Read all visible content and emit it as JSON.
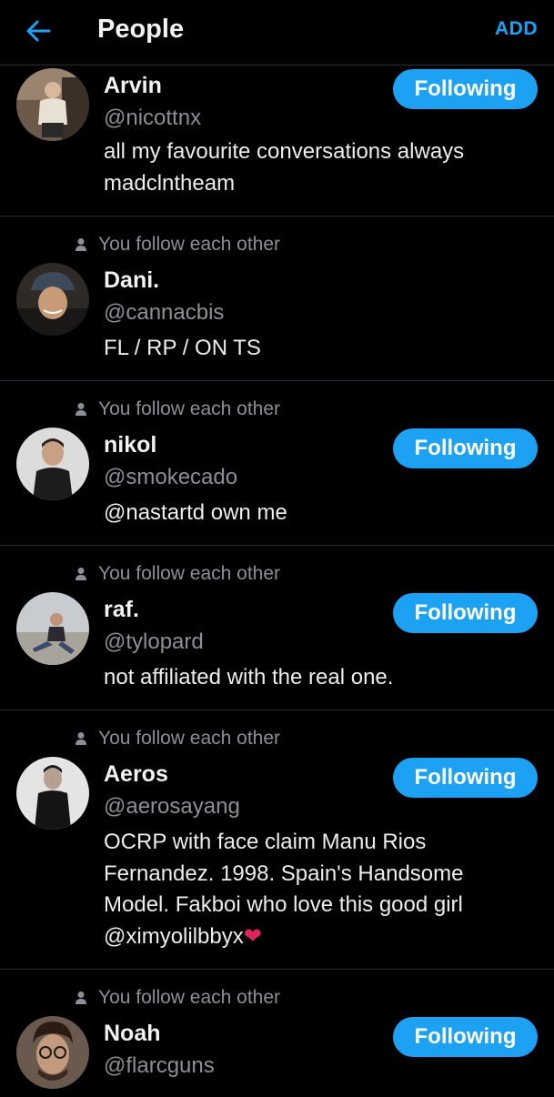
{
  "header": {
    "title": "People",
    "add_label": "ADD",
    "accent_color": "#1da1f2"
  },
  "social_context": "You follow each other",
  "follow_label": "Following",
  "people": [
    {
      "name": "Arvin",
      "handle": "@nicottnx",
      "bio": "all my favourite conversations always madclntheam",
      "mutual": false,
      "following": true
    },
    {
      "name": "Dani.",
      "handle": "@cannacbis",
      "bio": "FL / RP / ON TS",
      "mutual": true,
      "following": false
    },
    {
      "name": "nikol",
      "handle": "@smokecado",
      "bio": "@nastartd own me",
      "mutual": true,
      "following": true
    },
    {
      "name": "raf.",
      "handle": "@tylopard",
      "bio": "not affiliated with the real one.",
      "mutual": true,
      "following": true
    },
    {
      "name": "Aeros",
      "handle": "@aerosayang",
      "bio": "OCRP with face claim Manu Rios Fernandez. 1998. Spain's Handsome Model. Fakboi who love this good girl @ximyolilbbyx",
      "bio_emoji": "❤",
      "mutual": true,
      "following": true
    },
    {
      "name": "Noah",
      "handle": "@flarcguns",
      "bio": "",
      "mutual": true,
      "following": true
    }
  ]
}
